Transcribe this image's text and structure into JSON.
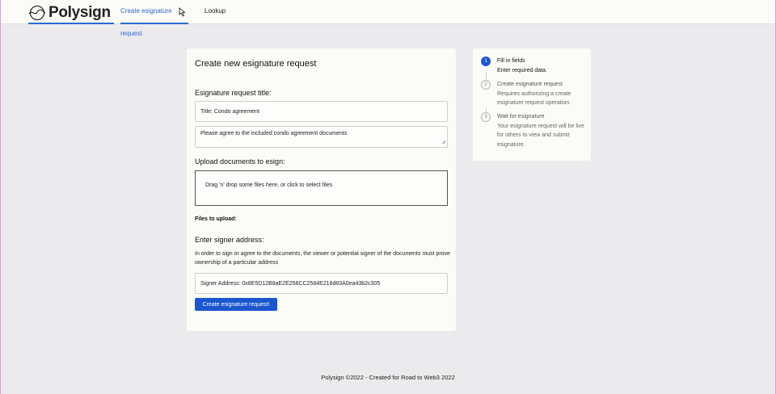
{
  "header": {
    "logo_text": "Polysign",
    "nav": [
      {
        "label": "Create esignature request",
        "active": true
      },
      {
        "label": "Lookup",
        "active": false
      }
    ]
  },
  "form": {
    "title": "Create new esignature request",
    "request_title_label": "Esignature request title:",
    "title_value": "Title: Condo agreement",
    "description_value": "Please agree to the included condo agreement documents",
    "upload_label": "Upload documents to esign:",
    "dropzone_text": "Drag 'n' drop some files here, or click to select files",
    "files_label": "Files to upload:",
    "signer_label": "Enter signer address:",
    "signer_description": "In order to sign or agree to the documents, the viewer or potential signer of the documents must prove ownership of a particular address",
    "signer_value": "Signer Address: 0x8E5D12B8aE2E256CC2584E218d83A0ea43b2c305",
    "submit_label": "Create esignature request!"
  },
  "steps": [
    {
      "number": "1",
      "title": "Fill in fields",
      "description": "Enter required data.",
      "status": "active"
    },
    {
      "number": "2",
      "title": "Create esignature request",
      "description": "Requires authorizing a create esignature request operation.",
      "status": "pending"
    },
    {
      "number": "3",
      "title": "Wait for esignature",
      "description": "Your esignature request will be live for others to view and submit esignature.",
      "status": "pending"
    }
  ],
  "footer": {
    "text": "Polysign ©2022 - Created for Road to Web3 2022"
  },
  "colors": {
    "accent": "#1c56cf",
    "page_bg": "#ebebed",
    "card_bg": "#fbfbf8"
  }
}
